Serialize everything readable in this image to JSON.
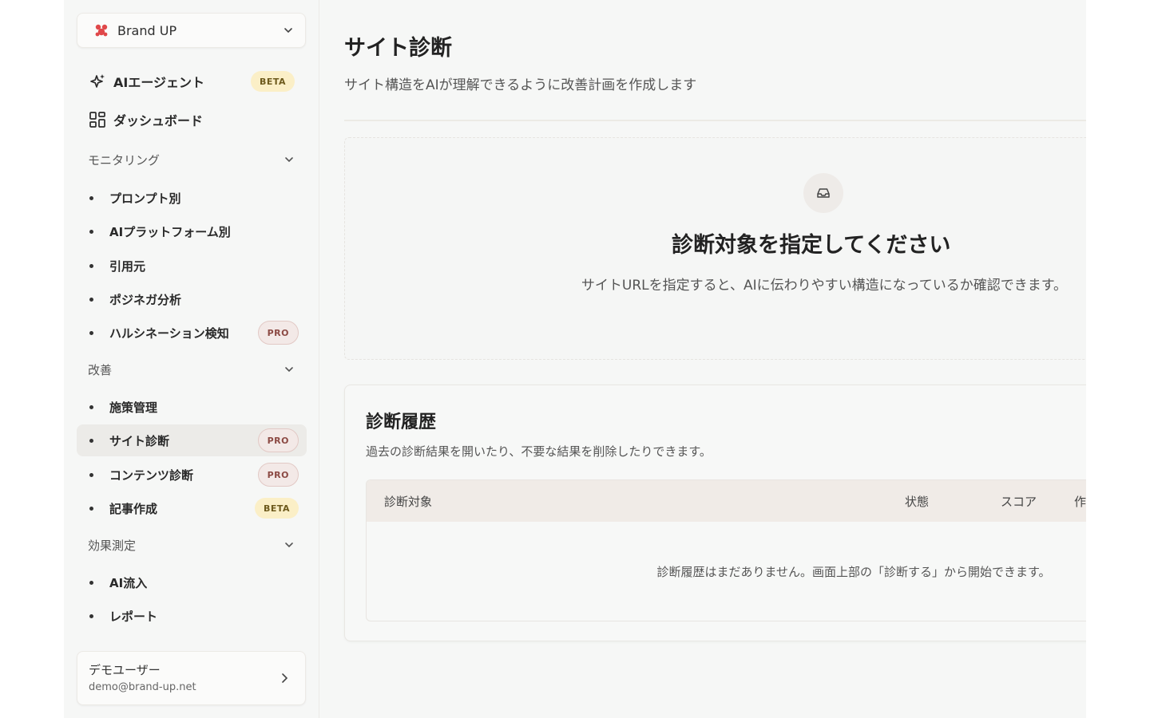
{
  "sidebar": {
    "brand": {
      "name": "Brand UP"
    },
    "agent": {
      "label": "AIエージェント",
      "badge": "BETA"
    },
    "dashboard": {
      "label": "ダッシュボード"
    },
    "monitoring": {
      "label": "モニタリング",
      "items": [
        {
          "label": "プロンプト別"
        },
        {
          "label": "AIプラットフォーム別"
        },
        {
          "label": "引用元"
        },
        {
          "label": "ポジネガ分析"
        },
        {
          "label": "ハルシネーション検知",
          "badge": "PRO"
        }
      ]
    },
    "improve": {
      "label": "改善",
      "items": [
        {
          "label": "施策管理"
        },
        {
          "label": "サイト診断",
          "badge": "PRO"
        },
        {
          "label": "コンテンツ診断",
          "badge": "PRO"
        },
        {
          "label": "記事作成",
          "badge": "BETA"
        }
      ]
    },
    "measure": {
      "label": "効果測定",
      "items": [
        {
          "label": "AI流入"
        },
        {
          "label": "レポート"
        }
      ]
    },
    "user": {
      "name": "デモユーザー",
      "email": "demo@brand-up.net"
    }
  },
  "main": {
    "title": "サイト診断",
    "subtitle": "サイト構造をAIが理解できるように改善計画を作成します",
    "empty": {
      "title": "診断対象を指定してください",
      "description": "サイトURLを指定すると、AIに伝わりやすい構造になっているか確認できます。"
    },
    "history": {
      "title": "診断履歴",
      "description": "過去の診断結果を開いたり、不要な結果を削除したりできます。",
      "columns": [
        "診断対象",
        "状態",
        "スコア",
        "作"
      ],
      "empty_message": "診断履歴はまだありません。画面上部の「診断する」から開始できます。"
    }
  },
  "colors": {
    "accent_logo": "#e0484a",
    "beta_badge_bg": "#fbefc7",
    "pro_badge_bg": "#f3e9e7",
    "active_item_bg": "#ecebe8",
    "table_header_bg": "#f0ebe7"
  }
}
